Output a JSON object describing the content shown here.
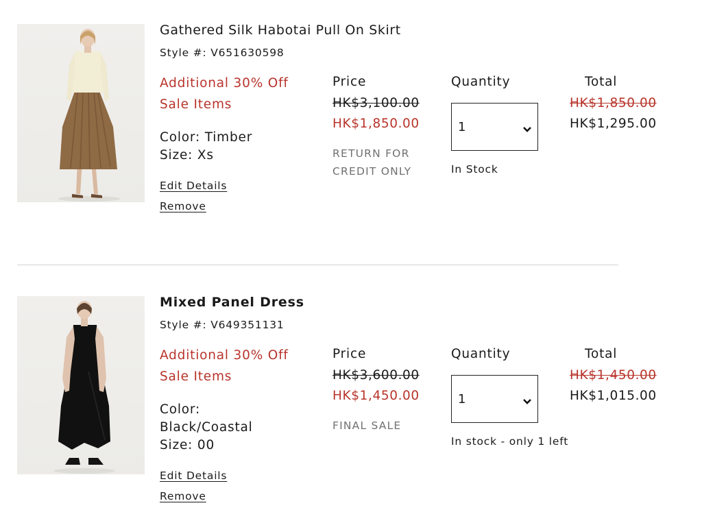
{
  "columns": {
    "price": "Price",
    "quantity": "Quantity",
    "total": "Total"
  },
  "items": [
    {
      "title": "Gathered Silk Habotai Pull On Skirt",
      "style": "Style #: V651630598",
      "promo_line1": "Additional 30% Off",
      "promo_line2": "Sale Items",
      "color": "Color: Timber",
      "size": "Size: Xs",
      "edit": "Edit Details",
      "remove": "Remove",
      "price_original": "HK$3,100.00",
      "price_sale": "HK$1,850.00",
      "note_line1": "RETURN FOR",
      "note_line2": "CREDIT ONLY",
      "quantity": "1",
      "stock": "In Stock",
      "total_original": "HK$1,850.00",
      "total_final": "HK$1,295.00",
      "image_icon": "model-skirt-photo"
    },
    {
      "title": "Mixed Panel Dress",
      "style": "Style #: V649351131",
      "promo_line1": "Additional 30% Off",
      "promo_line2": "Sale Items",
      "color_line1": "Color:",
      "color_line2": "Black/Coastal",
      "size": "Size: 00",
      "edit": "Edit Details",
      "remove": "Remove",
      "price_original": "HK$3,600.00",
      "price_sale": "HK$1,450.00",
      "note_line1": "FINAL SALE",
      "quantity": "1",
      "stock": "In stock - only 1 left",
      "total_original": "HK$1,450.00",
      "total_final": "HK$1,015.00",
      "image_icon": "model-dress-photo"
    }
  ],
  "colors": {
    "sale_red": "#b8342b",
    "muted_gray": "#707070",
    "divider": "#d4d4d4"
  }
}
